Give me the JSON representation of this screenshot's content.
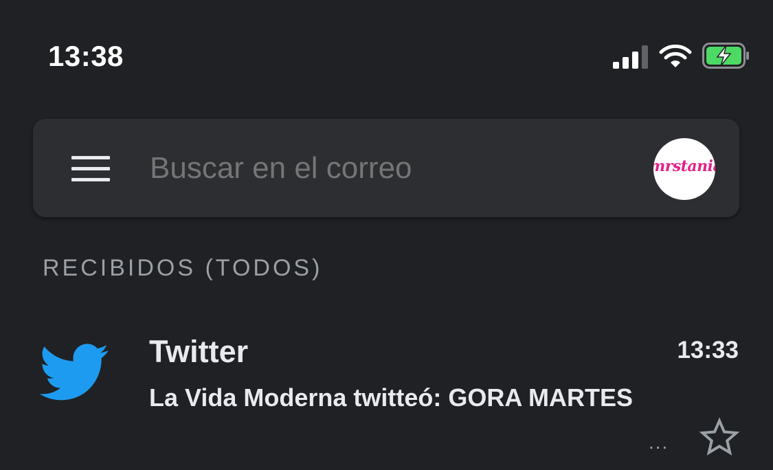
{
  "status_bar": {
    "time": "13:38",
    "icons": [
      "signal-icon",
      "wifi-icon",
      "battery-charging-icon"
    ]
  },
  "search": {
    "placeholder": "Buscar en el correo",
    "menu_icon": "menu-icon",
    "avatar_text": "mrstania"
  },
  "section": {
    "label": "RECIBIDOS (TODOS)"
  },
  "emails": [
    {
      "icon": "twitter-icon",
      "sender": "Twitter",
      "time": "13:33",
      "subject": "La Vida Moderna twitteó: GORA MARTES",
      "more": "...",
      "starred": false
    }
  ],
  "colors": {
    "background": "#202124",
    "search_bar": "#2d2e31",
    "twitter_blue": "#1d9bf0",
    "battery_green": "#4cd964",
    "avatar_text": "#e0218a"
  }
}
